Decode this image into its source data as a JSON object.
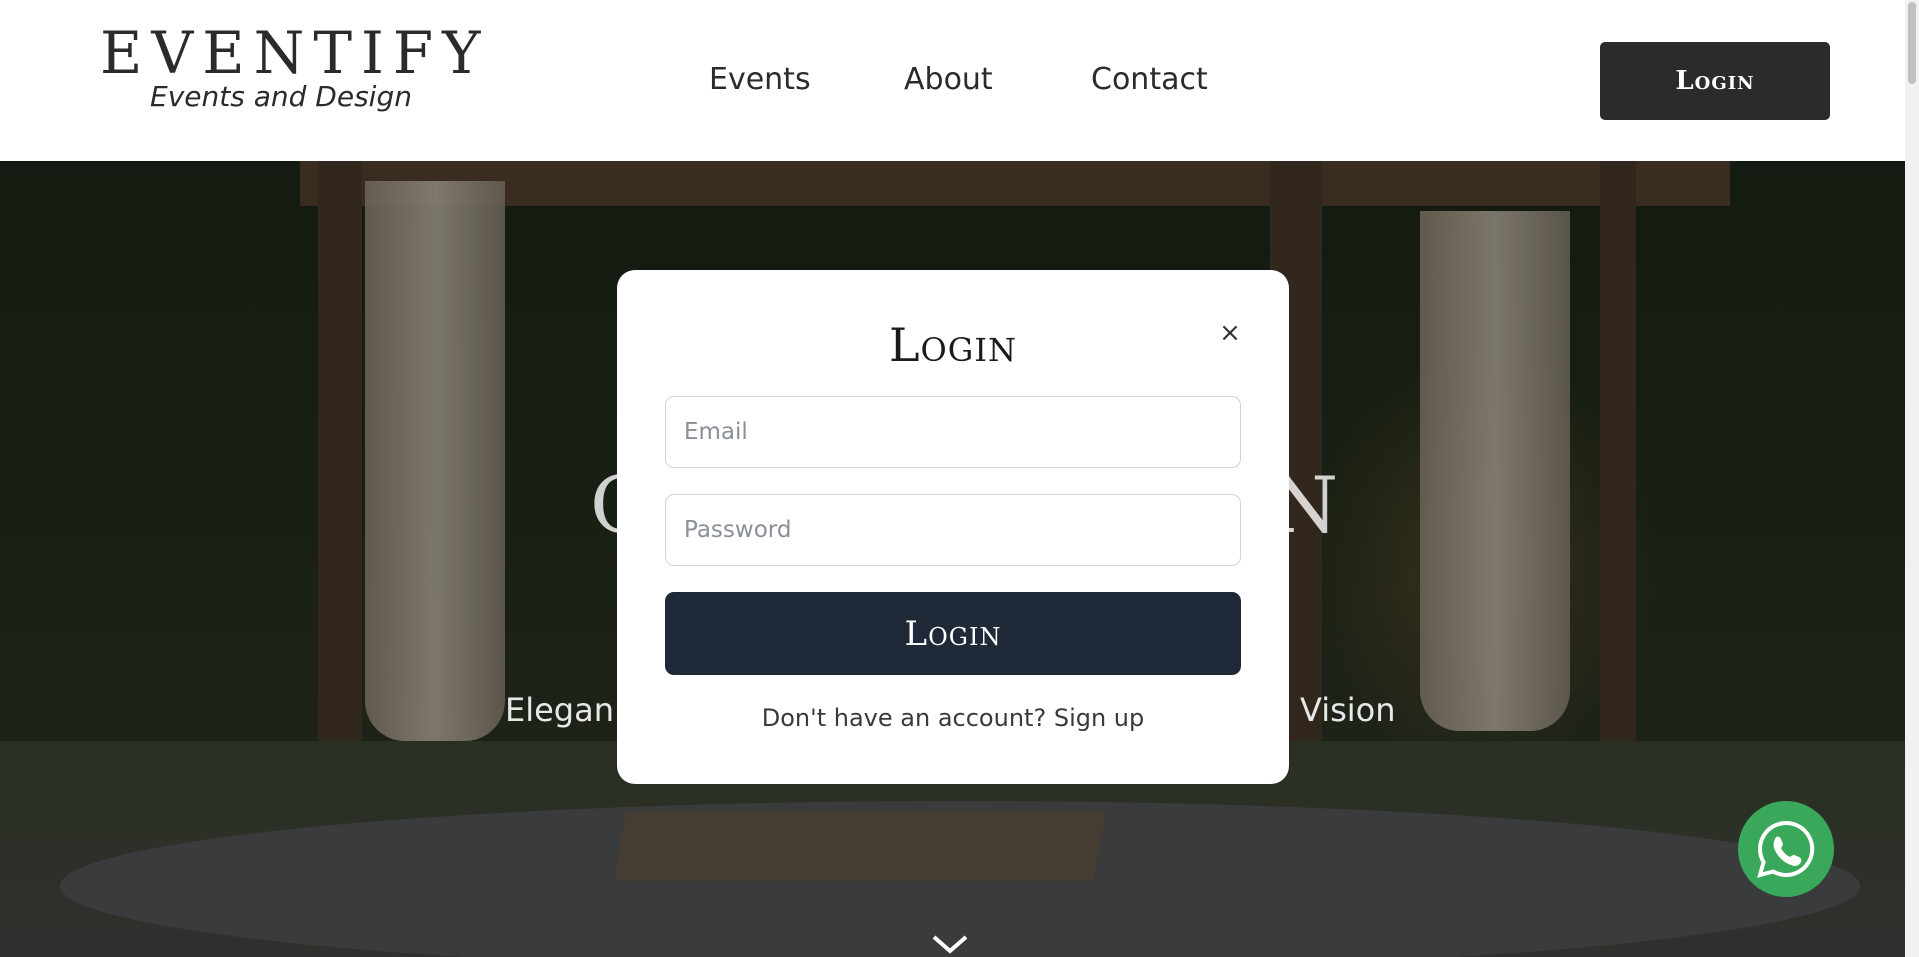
{
  "header": {
    "logo_title": "EVENTIFY",
    "logo_subtitle": "Events and Design",
    "nav": [
      "Events",
      "About",
      "Contact"
    ],
    "login_label": "Login"
  },
  "hero": {
    "heading_left": "C",
    "heading_right": "N",
    "subtitle_left": "Elegan",
    "subtitle_right": "Vision"
  },
  "modal": {
    "title": "Login",
    "close_symbol": "×",
    "email_placeholder": "Email",
    "password_placeholder": "Password",
    "submit_label": "Login",
    "signup_prompt": "Don't have an account?",
    "signup_link": "Sign up"
  },
  "colors": {
    "header_button": "#2b2b2b",
    "modal_button": "#1f2937",
    "whatsapp": "#3aa85a"
  },
  "icons": [
    "close-icon",
    "chevron-down-icon",
    "whatsapp-icon"
  ]
}
